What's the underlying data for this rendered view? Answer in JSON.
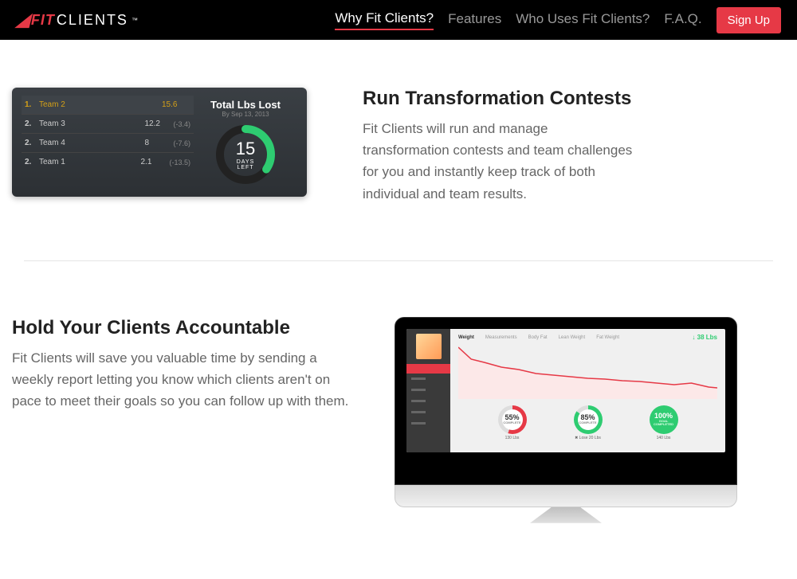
{
  "brand": {
    "fit": "FIT",
    "clients": "CLIENTS",
    "tm": "™"
  },
  "nav": {
    "why": "Why Fit Clients?",
    "features": "Features",
    "who": "Who Uses Fit Clients?",
    "faq": "F.A.Q.",
    "signup": "Sign Up"
  },
  "contest_widget": {
    "title": "Total Lbs Lost",
    "date": "By Sep 13, 2013",
    "days_num": "15",
    "days_label": "DAYS LEFT",
    "teams": [
      {
        "rank": "1.",
        "name": "Team 2",
        "score": "15.6",
        "diff": ""
      },
      {
        "rank": "2.",
        "name": "Team 3",
        "score": "12.2",
        "diff": "(-3.4)"
      },
      {
        "rank": "2.",
        "name": "Team 4",
        "score": "8",
        "diff": "(-7.6)"
      },
      {
        "rank": "2.",
        "name": "Team 1",
        "score": "2.1",
        "diff": "(-13.5)"
      }
    ]
  },
  "section1": {
    "heading": "Run Transformation Contests",
    "body": "Fit Clients will run and manage transformation contests and team challenges for you and instantly keep track of both individual and team results."
  },
  "section2": {
    "heading": "Hold Your Clients Accountable",
    "body": "Fit Clients will save you valuable time by sending a weekly report letting you know which clients aren't on pace to meet their goals so you can follow up with them."
  },
  "imac": {
    "tabs": [
      "Weight",
      "Measurements",
      "Body Fat",
      "Lean Weight",
      "Fat Weight"
    ],
    "badge": "↓ 38 Lbs",
    "gauges": [
      {
        "pct": "55%",
        "sub": "COMPLETE",
        "label": "130 Lbs"
      },
      {
        "pct": "85%",
        "sub": "COMPLETE",
        "label": "✖ Lose 20 Lbs"
      },
      {
        "pct": "100%",
        "sub": "GOAL COMPLETED",
        "label": "140 Lbs"
      }
    ]
  },
  "chart_data": {
    "type": "line",
    "title": "Weight",
    "series": [
      {
        "name": "weight",
        "values": [
          172,
          165,
          162,
          158,
          156,
          152,
          150,
          148,
          146,
          145,
          143,
          142,
          140,
          138,
          137,
          136,
          135,
          134
        ]
      }
    ],
    "ylim": [
      130,
      175
    ]
  }
}
